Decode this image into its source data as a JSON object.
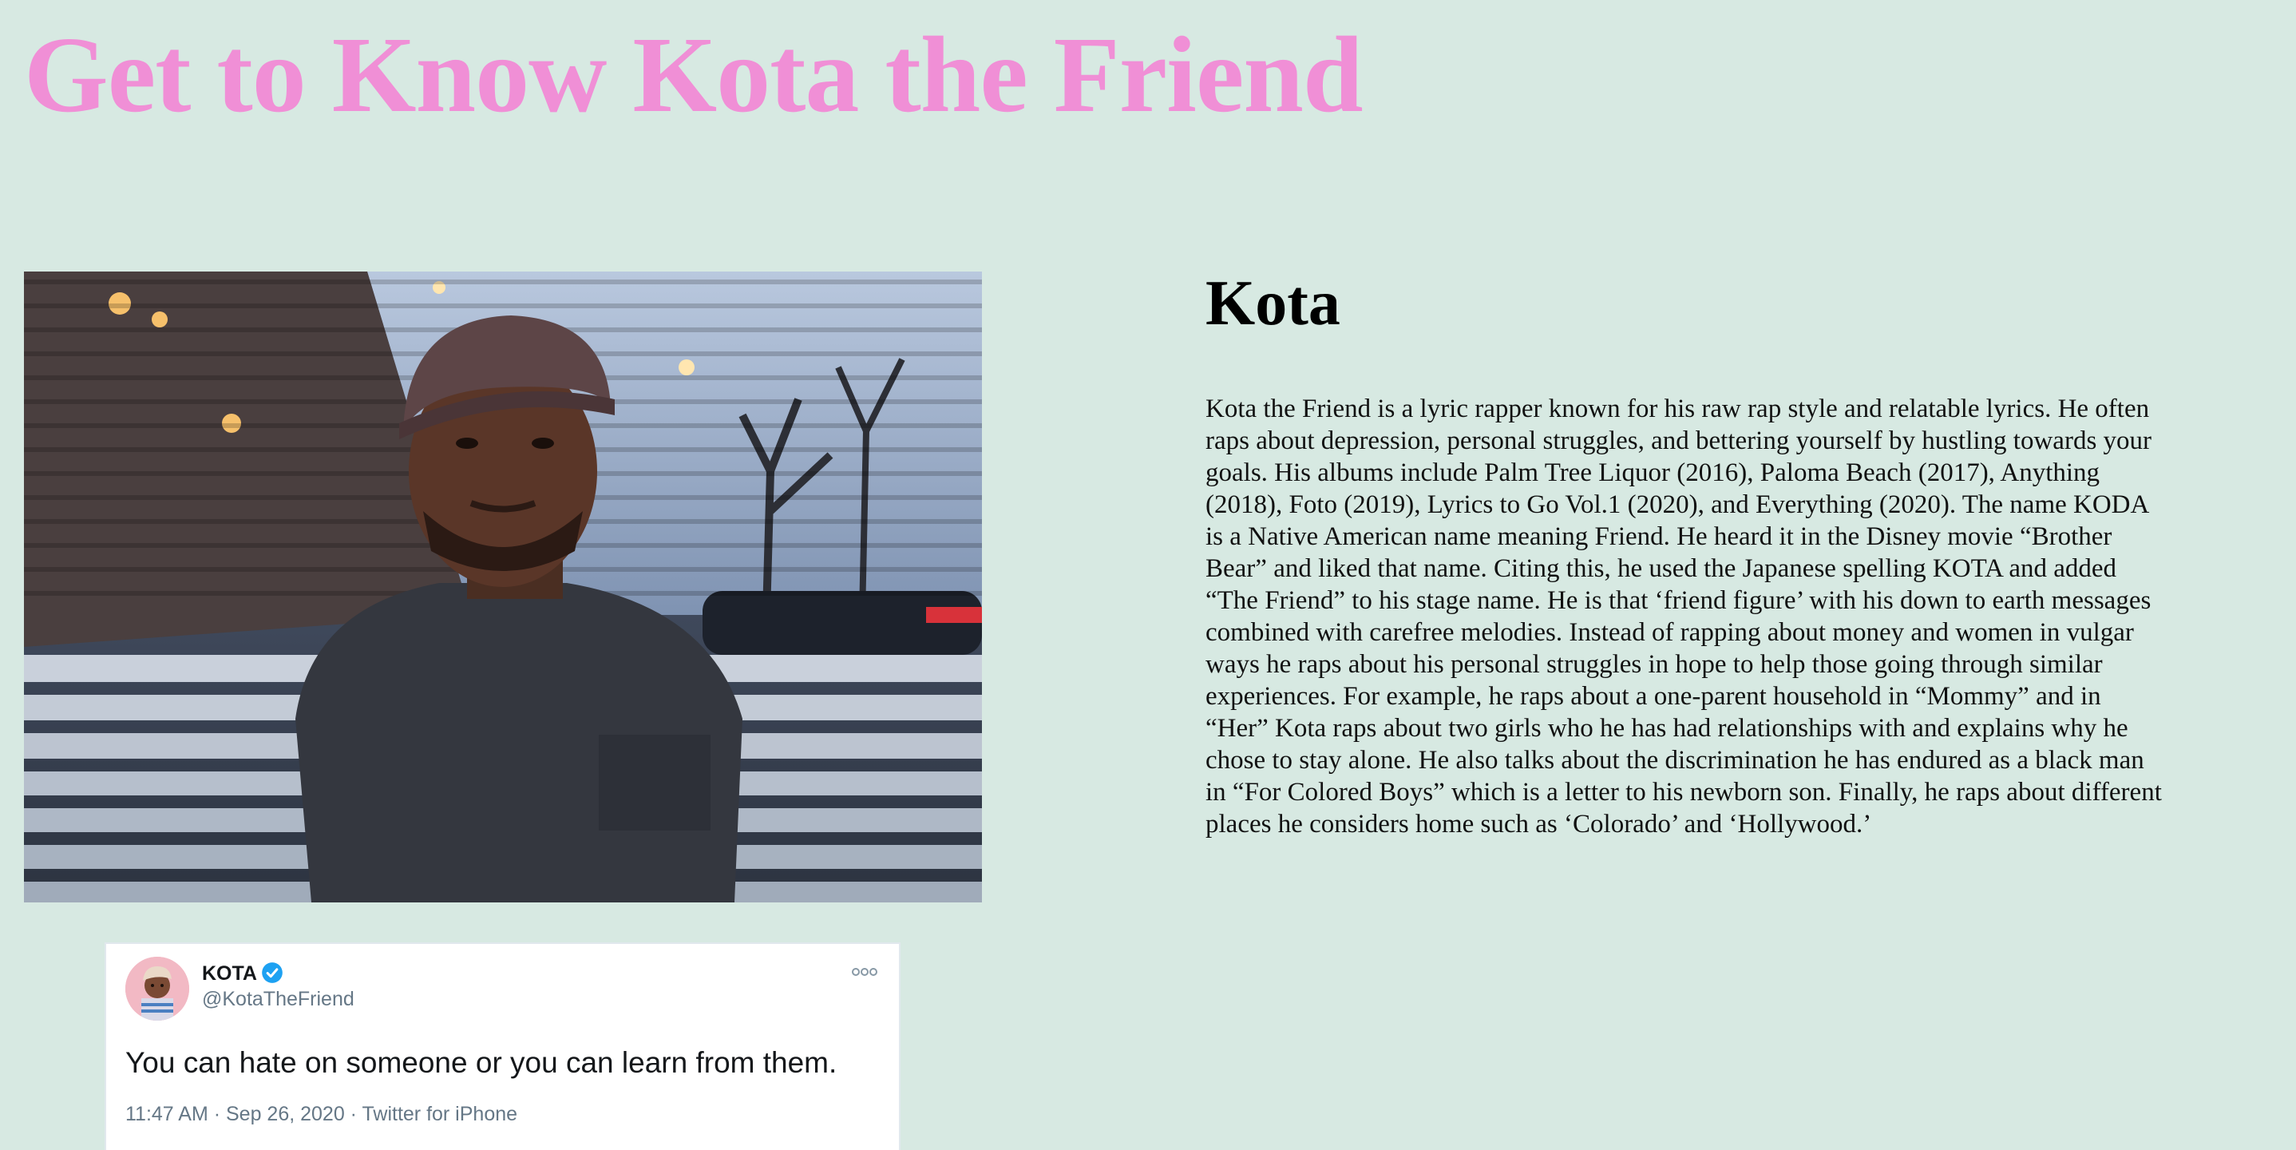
{
  "page": {
    "title": "Get to Know Kota the Friend",
    "title_color": "#f08fd6",
    "background_color": "#d7e9e2"
  },
  "photo": {
    "icon": "portrait-photo"
  },
  "bio": {
    "heading": "Kota",
    "text": "Kota the Friend is a lyric rapper known for his raw rap style and relatable lyrics. He often raps about depression, personal struggles, and bettering yourself by hustling towards your goals. His albums include Palm Tree Liquor (2016), Paloma Beach (2017), Anything (2018), Foto (2019), Lyrics to Go Vol.1 (2020), and Everything (2020). The name KODA is a Native American name meaning Friend. He heard it in the Disney movie “Brother Bear” and liked that name. Citing this, he used the Japanese spelling KOTA and added “The Friend” to his stage name. He is that ‘friend figure’ with his down to earth messages combined with carefree melodies. Instead of rapping about money and women in vulgar ways he raps about his personal struggles in hope to help those going through similar experiences. For example, he raps about a one-parent household in “Mommy” and in “Her” Kota raps about two girls who he has had relationships with and explains why he chose to stay alone. He also talks about the discrimination he has endured as a black man in “For Colored Boys” which is a letter to his newborn son. Finally, he raps about different places he considers home such as ‘Colorado’ and ‘Hollywood.’"
  },
  "tweet": {
    "name": "KOTA",
    "handle": "@KotaTheFriend",
    "text": "You can hate on someone or you can learn from them.",
    "meta": "11:47 AM · Sep 26, 2020 · Twitter for iPhone",
    "verified_color": "#1da1f2"
  }
}
